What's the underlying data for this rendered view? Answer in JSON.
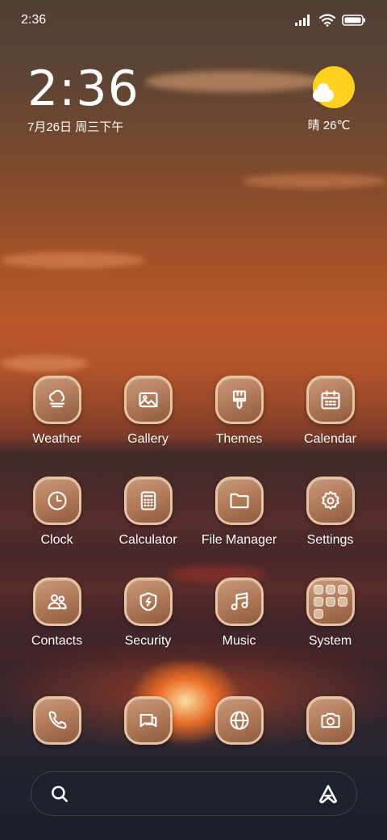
{
  "status_bar": {
    "time": "2:36"
  },
  "clock_widget": {
    "time": "2:36",
    "date": "7月26日 周三下午"
  },
  "weather_widget": {
    "summary": "晴 26℃",
    "icon": "sunny-cloud-icon",
    "sun_color": "#ffd21e"
  },
  "apps": [
    [
      {
        "label": "Weather",
        "icon": "weather-icon"
      },
      {
        "label": "Gallery",
        "icon": "gallery-icon"
      },
      {
        "label": "Themes",
        "icon": "themes-icon"
      },
      {
        "label": "Calendar",
        "icon": "calendar-icon"
      }
    ],
    [
      {
        "label": "Clock",
        "icon": "clock-icon"
      },
      {
        "label": "Calculator",
        "icon": "calculator-icon"
      },
      {
        "label": "File Manager",
        "icon": "folder-icon"
      },
      {
        "label": "Settings",
        "icon": "gear-icon"
      }
    ],
    [
      {
        "label": "Contacts",
        "icon": "contacts-icon"
      },
      {
        "label": "Security",
        "icon": "shield-icon"
      },
      {
        "label": "Music",
        "icon": "music-icon"
      },
      {
        "label": "System",
        "icon": "folder-grid-icon"
      }
    ]
  ],
  "dock": [
    {
      "icon": "phone-icon"
    },
    {
      "icon": "messages-icon"
    },
    {
      "icon": "browser-icon"
    },
    {
      "icon": "camera-icon"
    }
  ],
  "search_bar": {
    "left_icon": "search-icon",
    "right_icon": "assistant-icon"
  },
  "theme": {
    "icon_tint": "#b07a5a",
    "icon_border": "#e6c3a3"
  }
}
